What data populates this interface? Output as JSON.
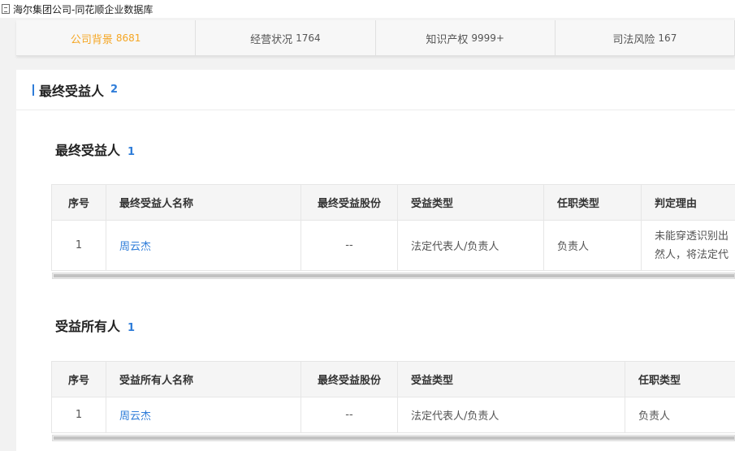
{
  "window": {
    "title": "海尔集团公司-同花顺企业数据库"
  },
  "tabs": [
    {
      "label": "公司背景",
      "count": "8681",
      "active": true
    },
    {
      "label": "经营状况",
      "count": "1764"
    },
    {
      "label": "知识产权",
      "count": "9999+"
    },
    {
      "label": "司法风险",
      "count": "167"
    }
  ],
  "section": {
    "title": "最终受益人",
    "count": "2"
  },
  "ubo": {
    "title": "最终受益人",
    "count": "1",
    "headers": [
      "序号",
      "最终受益人名称",
      "最终受益股份",
      "受益类型",
      "任职类型",
      "判定理由"
    ],
    "rows": [
      {
        "index": "1",
        "name": "周云杰",
        "share": "--",
        "benefit_type": "法定代表人/负责人",
        "role": "负责人",
        "reason_line1": "未能穿透识别出",
        "reason_line2": "然人，将法定代"
      }
    ]
  },
  "owner": {
    "title": "受益所有人",
    "count": "1",
    "headers": [
      "序号",
      "受益所有人名称",
      "最终受益股份",
      "受益类型",
      "任职类型"
    ],
    "rows": [
      {
        "index": "1",
        "name": "周云杰",
        "share": "--",
        "benefit_type": "法定代表人/负责人",
        "role": "负责人"
      }
    ]
  }
}
